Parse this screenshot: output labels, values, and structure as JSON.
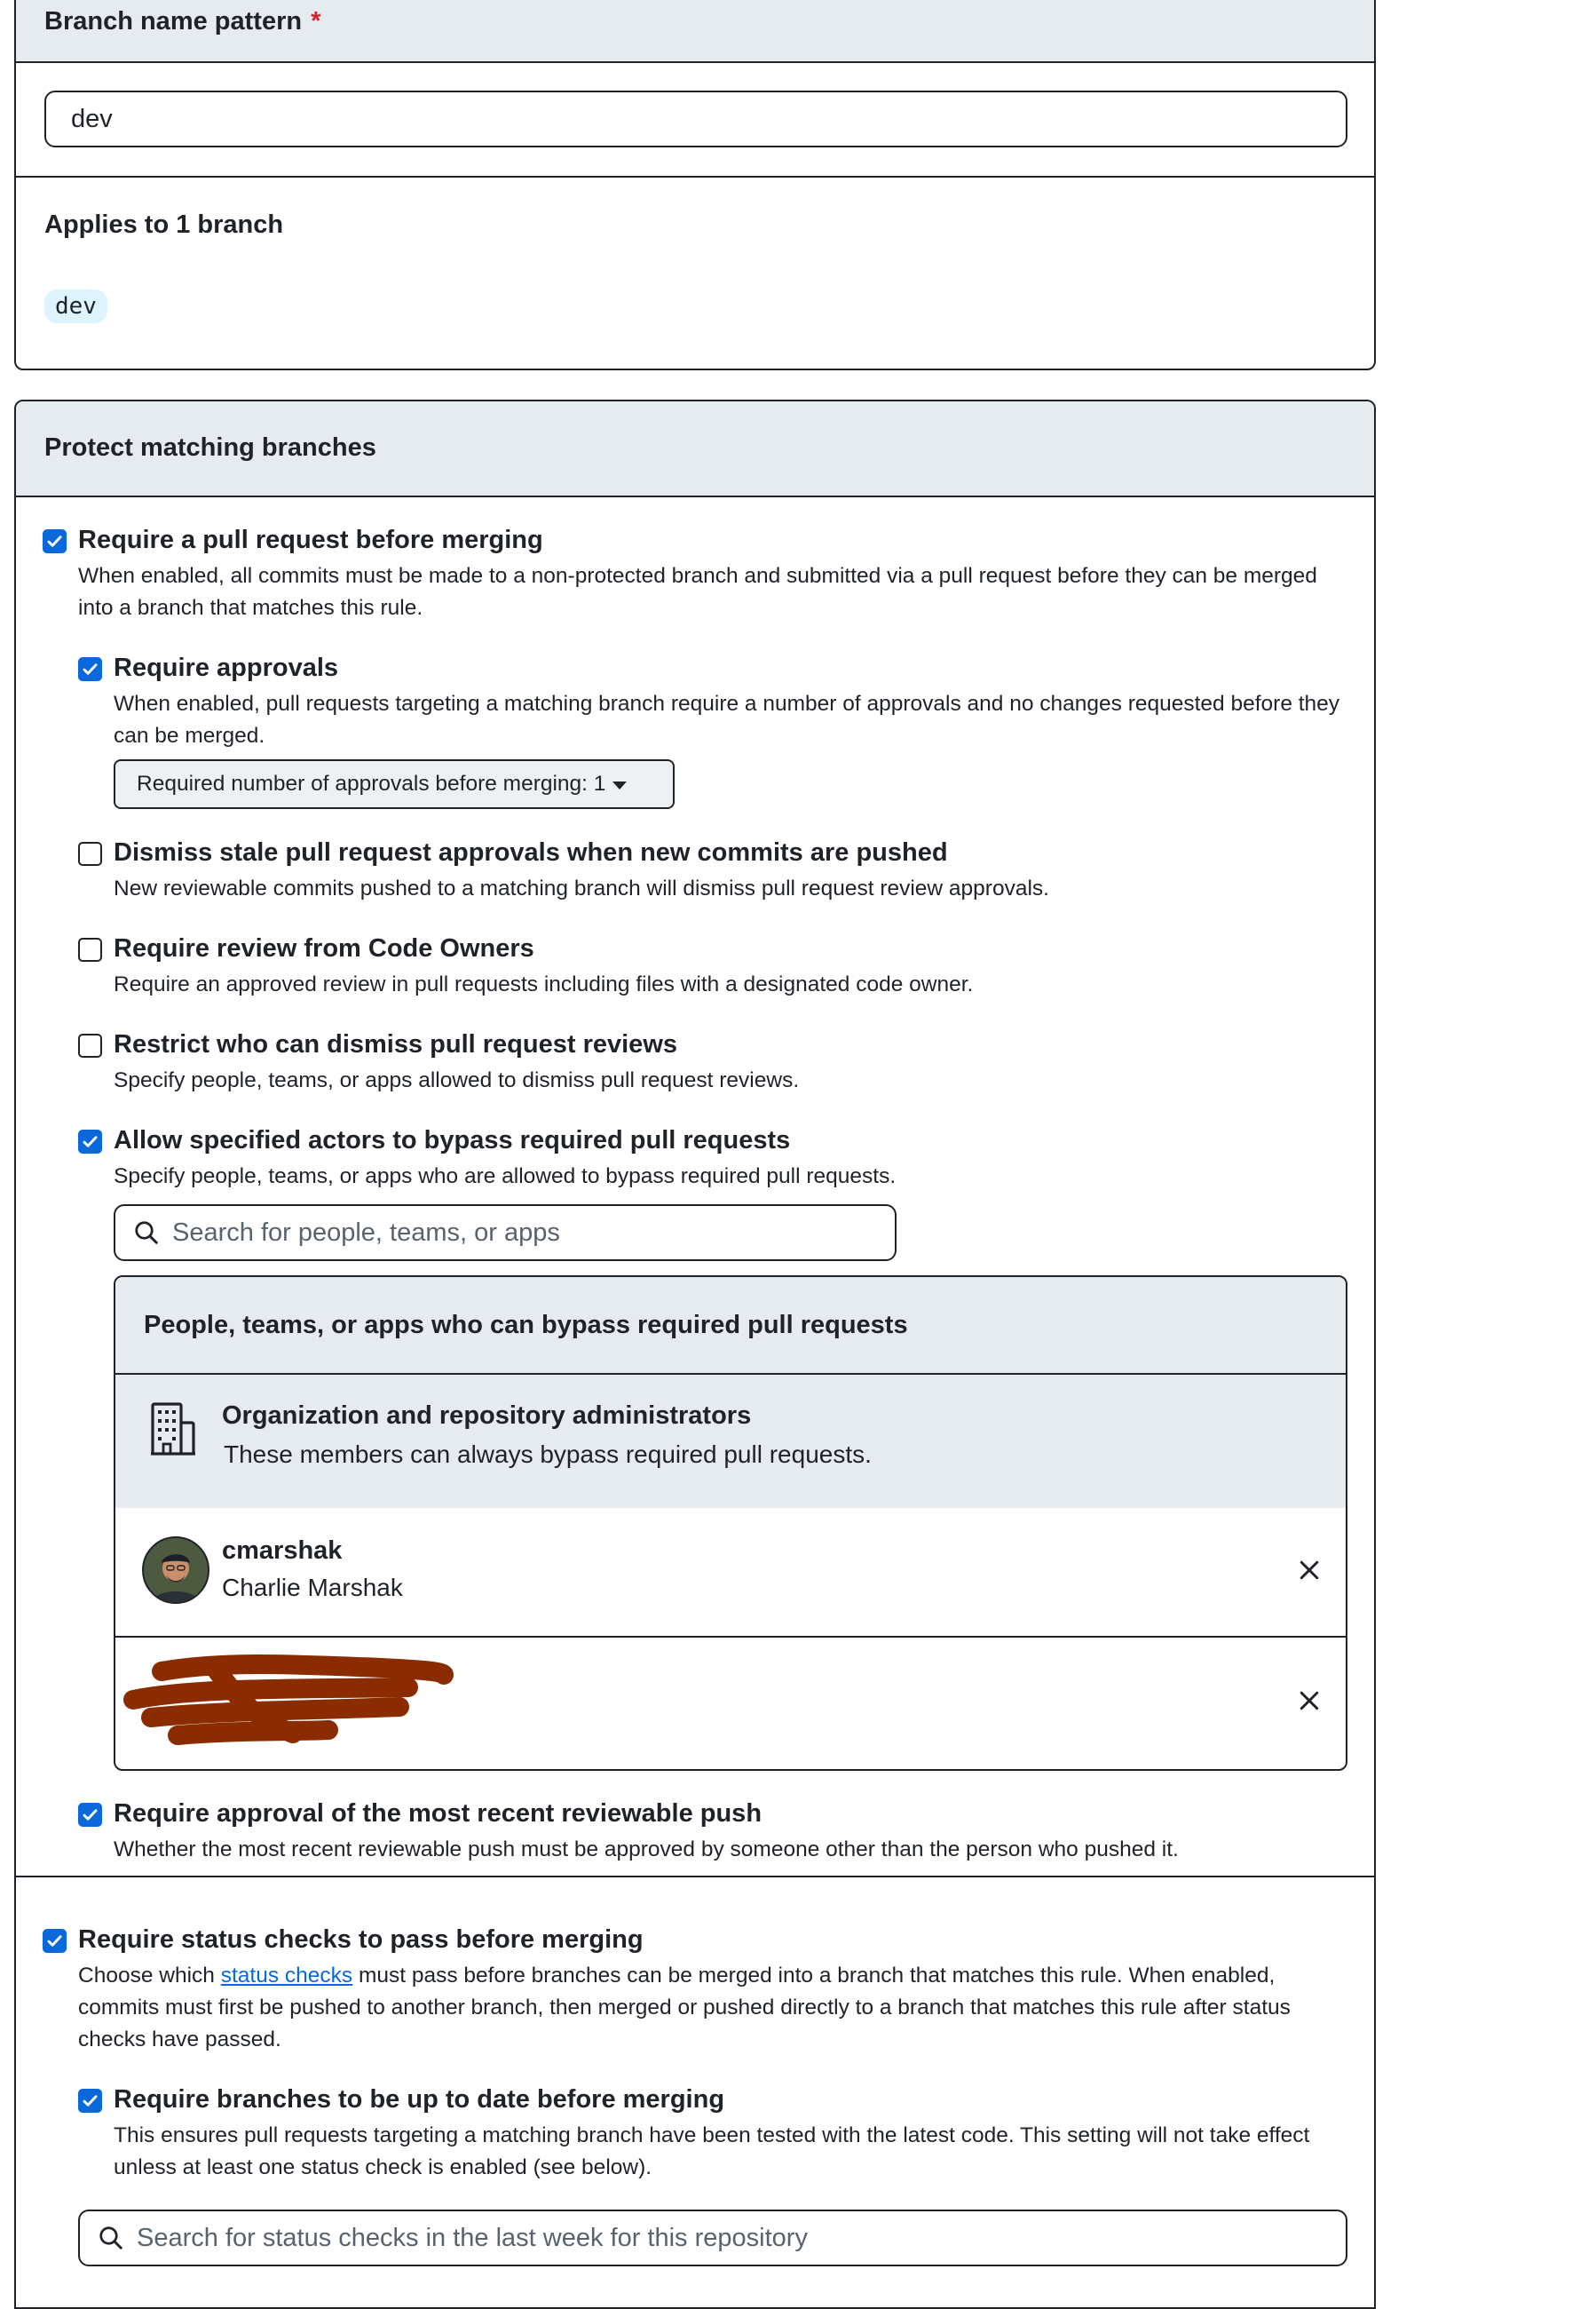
{
  "branch_pattern": {
    "label": "Branch name pattern",
    "required_mark": "*",
    "value": "dev"
  },
  "applies": {
    "heading": "Applies to 1 branch",
    "branches": [
      "dev"
    ]
  },
  "protect": {
    "heading": "Protect matching branches",
    "require_pr": {
      "checked": true,
      "title": "Require a pull request before merging",
      "description": "When enabled, all commits must be made to a non-protected branch and submitted via a pull request before they can be merged into a branch that matches this rule."
    },
    "require_approvals": {
      "checked": true,
      "title": "Require approvals",
      "description": "When enabled, pull requests targeting a matching branch require a number of approvals and no changes requested before they can be merged.",
      "select_label": "Required number of approvals before merging: 1"
    },
    "dismiss_stale": {
      "checked": false,
      "title": "Dismiss stale pull request approvals when new commits are pushed",
      "description": "New reviewable commits pushed to a matching branch will dismiss pull request review approvals."
    },
    "code_owners": {
      "checked": false,
      "title": "Require review from Code Owners",
      "description": "Require an approved review in pull requests including files with a designated code owner."
    },
    "restrict_dismiss": {
      "checked": false,
      "title": "Restrict who can dismiss pull request reviews",
      "description": "Specify people, teams, or apps allowed to dismiss pull request reviews."
    },
    "allow_bypass": {
      "checked": true,
      "title": "Allow specified actors to bypass required pull requests",
      "description": "Specify people, teams, or apps who are allowed to bypass required pull requests.",
      "search_placeholder": "Search for people, teams, or apps",
      "list_heading": "People, teams, or apps who can bypass required pull requests",
      "admins_title": "Organization and repository administrators",
      "admins_desc": "These members can always bypass required pull requests.",
      "actors": [
        {
          "login": "cmarshak",
          "name": "Charlie Marshak"
        }
      ]
    },
    "recent_push": {
      "checked": true,
      "title": "Require approval of the most recent reviewable push",
      "description": "Whether the most recent reviewable push must be approved by someone other than the person who pushed it."
    },
    "status_checks": {
      "checked": true,
      "title": "Require status checks to pass before merging",
      "desc_before": "Choose which ",
      "desc_link": "status checks",
      "desc_after": " must pass before branches can be merged into a branch that matches this rule. When enabled, commits must first be pushed to another branch, then merged or pushed directly to a branch that matches this rule after status checks have passed."
    },
    "up_to_date": {
      "checked": true,
      "title": "Require branches to be up to date before merging",
      "description": "This ensures pull requests targeting a matching branch have been tested with the latest code. This setting will not take effect unless at least one status check is enabled (see below).",
      "search_placeholder": "Search for status checks in the last week for this repository"
    }
  },
  "colors": {
    "accent": "#0969da",
    "header_bg": "#e6ebf0",
    "required": "#d1242f",
    "redaction": "#8b2c00"
  }
}
